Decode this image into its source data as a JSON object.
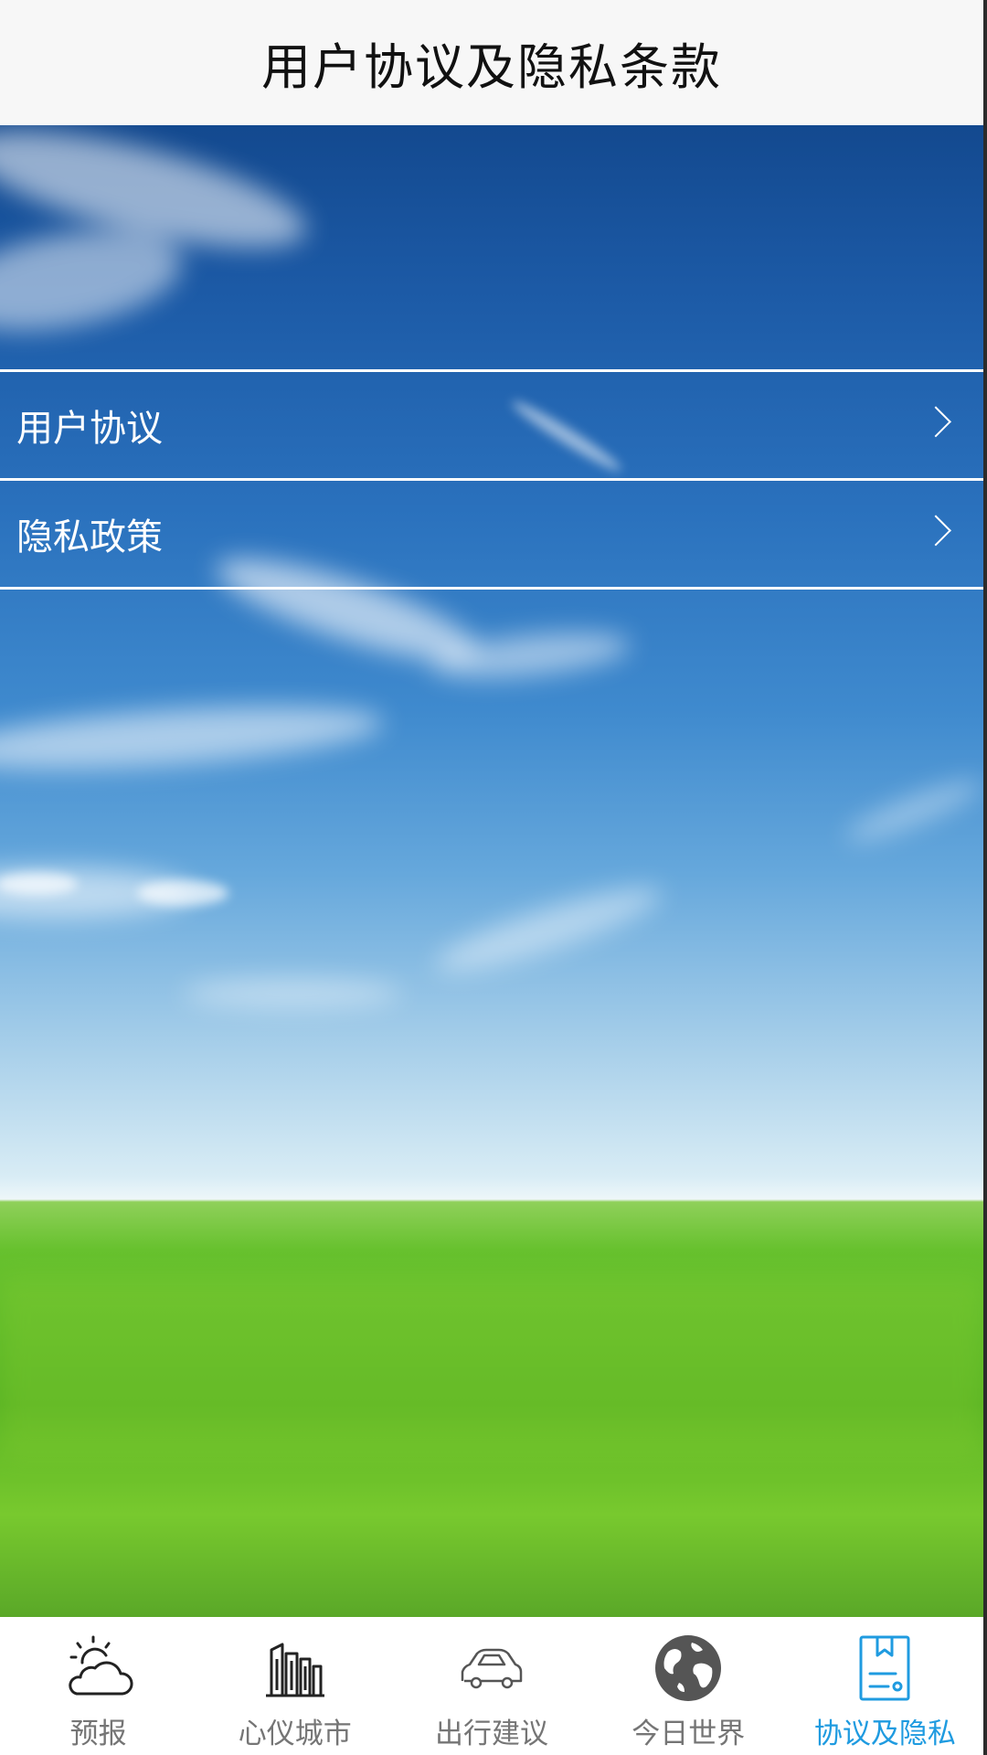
{
  "header": {
    "title": "用户协议及隐私条款"
  },
  "menu": {
    "items": [
      {
        "label": "用户协议"
      },
      {
        "label": "隐私政策"
      }
    ]
  },
  "tabbar": {
    "active_color": "#1f9be0",
    "inactive_color": "#757575",
    "tabs": [
      {
        "label": "预报",
        "icon": "weather-icon"
      },
      {
        "label": "心仪城市",
        "icon": "buildings-icon"
      },
      {
        "label": "出行建议",
        "icon": "car-icon"
      },
      {
        "label": "今日世界",
        "icon": "globe-icon"
      },
      {
        "label": "协议及隐私",
        "icon": "document-icon",
        "active": true
      }
    ]
  }
}
